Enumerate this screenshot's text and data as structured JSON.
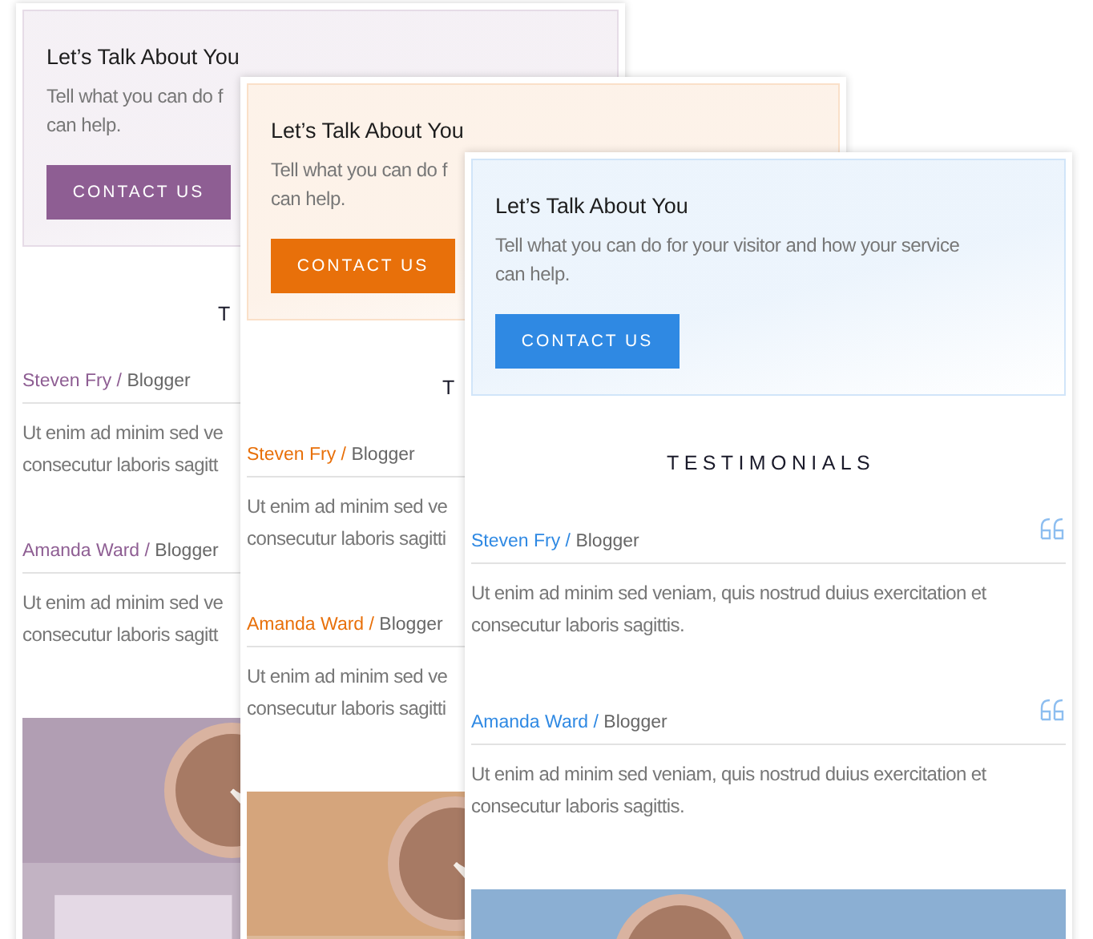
{
  "cards": [
    {
      "color": "#8e5e93",
      "cta": {
        "title": "Let’s Talk About You",
        "description_lines": [
          "Tell what you can do f",
          "can help."
        ],
        "button": "CONTACT US"
      },
      "heading": "T",
      "testimonials": [
        {
          "author": "Steven Fry /",
          "role": "Blogger",
          "quote_mark": false,
          "quote_lines": [
            "Ut enim ad minim sed ve",
            "consecutur laboris sagitt"
          ]
        },
        {
          "author": "Amanda Ward /",
          "role": "Blogger",
          "quote_mark": false,
          "quote_lines": [
            "Ut enim ad minim sed ve",
            "consecutur laboris sagitt"
          ]
        }
      ],
      "picture": {
        "kind": "picture"
      }
    },
    {
      "color": "#e8700a",
      "cta": {
        "title": "Let’s Talk About You",
        "description_lines": [
          "Tell what you can do f",
          "can help."
        ],
        "button": "CONTACT US"
      },
      "heading": "T",
      "testimonials": [
        {
          "author": "Steven Fry /",
          "role": "Blogger",
          "quote_mark": false,
          "quote_lines": [
            "Ut enim ad minim sed ve",
            "consecutur laboris sagitti"
          ]
        },
        {
          "author": "Amanda Ward /",
          "role": "Blogger",
          "quote_mark": false,
          "quote_lines": [
            "Ut enim ad minim sed ve",
            "consecutur laboris sagitti"
          ]
        }
      ],
      "picture": {
        "kind": "picture"
      }
    },
    {
      "color": "#2f89e3",
      "cta": {
        "title": "Let’s Talk About You",
        "description_lines": [
          "Tell what you can do for your visitor and how your service",
          "can help."
        ],
        "button": "CONTACT US"
      },
      "heading": "TESTIMONIALS",
      "testimonials": [
        {
          "author": "Steven Fry /",
          "role": "Blogger",
          "quote_mark": true,
          "quote_lines": [
            "Ut enim ad minim sed veniam, quis nostrud duius exercitation et",
            "consecutur laboris sagittis."
          ]
        },
        {
          "author": "Amanda Ward /",
          "role": "Blogger",
          "quote_mark": true,
          "quote_lines": [
            "Ut enim ad minim sed veniam, quis nostrud duius exercitation et",
            "consecutur laboris sagittis."
          ]
        }
      ],
      "picture": {
        "kind": "picture"
      }
    }
  ]
}
